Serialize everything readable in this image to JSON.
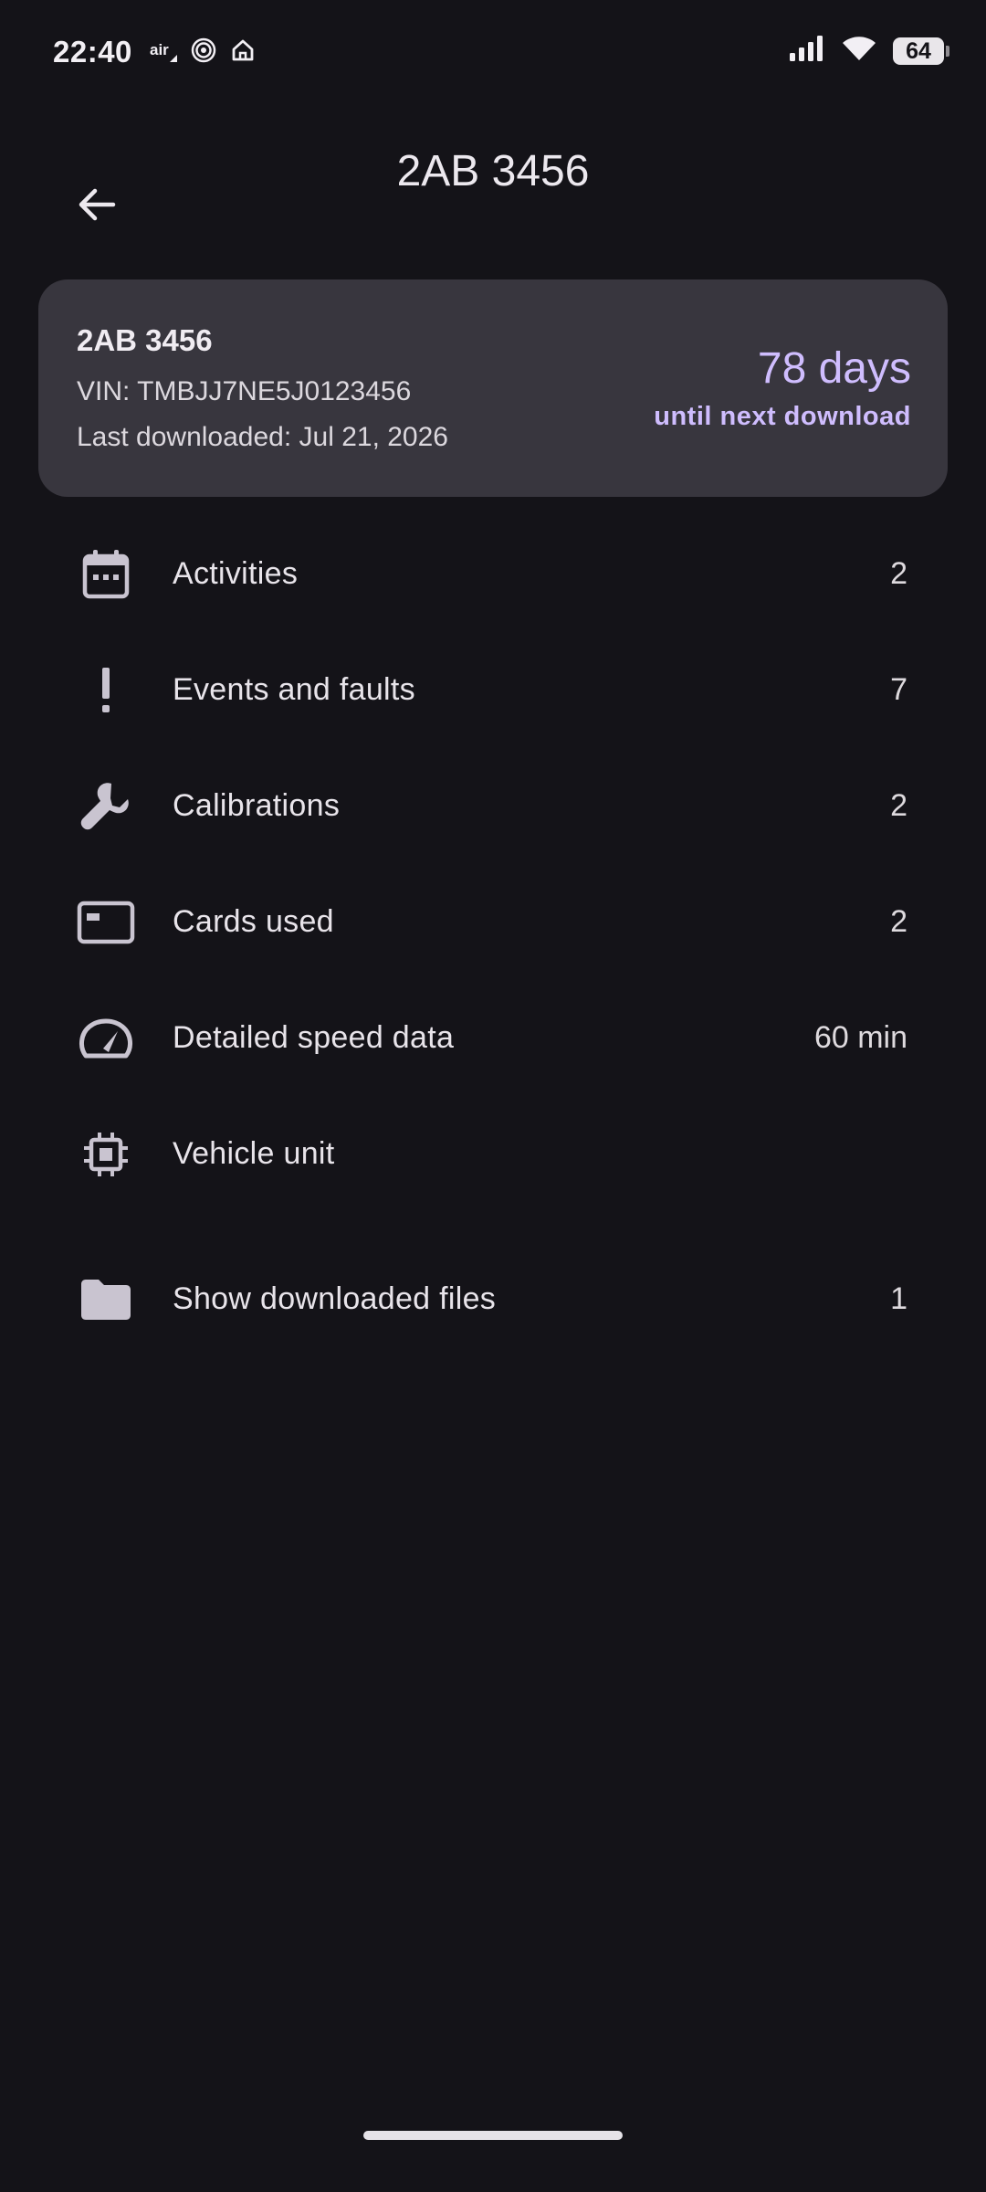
{
  "status_bar": {
    "time": "22:40",
    "left_icons": [
      "air-icon",
      "target-icon",
      "home-icon"
    ],
    "right_icons": [
      "signal-icon",
      "wifi-icon",
      "battery-icon"
    ],
    "battery_level": "64"
  },
  "header": {
    "title": "2AB 3456",
    "back_icon": "arrow-back-icon"
  },
  "card": {
    "plate": "2AB 3456",
    "vin": "VIN: TMBJJ7NE5J0123456",
    "last_downloaded": "Last downloaded: Jul 21, 2026",
    "days": "78 days",
    "until": "until next download"
  },
  "menu": {
    "items": [
      {
        "icon": "calendar-icon",
        "label": "Activities",
        "value": "2"
      },
      {
        "icon": "exclamation-icon",
        "label": "Events and faults",
        "value": "7"
      },
      {
        "icon": "wrench-icon",
        "label": "Calibrations",
        "value": "2"
      },
      {
        "icon": "card-icon",
        "label": "Cards used",
        "value": "2"
      },
      {
        "icon": "speedometer-icon",
        "label": "Detailed speed data",
        "value": "60 min"
      },
      {
        "icon": "chip-icon",
        "label": "Vehicle unit",
        "value": ""
      },
      {
        "icon": "folder-icon",
        "label": "Show downloaded files",
        "value": "1"
      }
    ]
  },
  "colors": {
    "background": "#141318",
    "card": "#38363e",
    "accent": "#cfbdfe",
    "icon": "#c9c4d0"
  }
}
